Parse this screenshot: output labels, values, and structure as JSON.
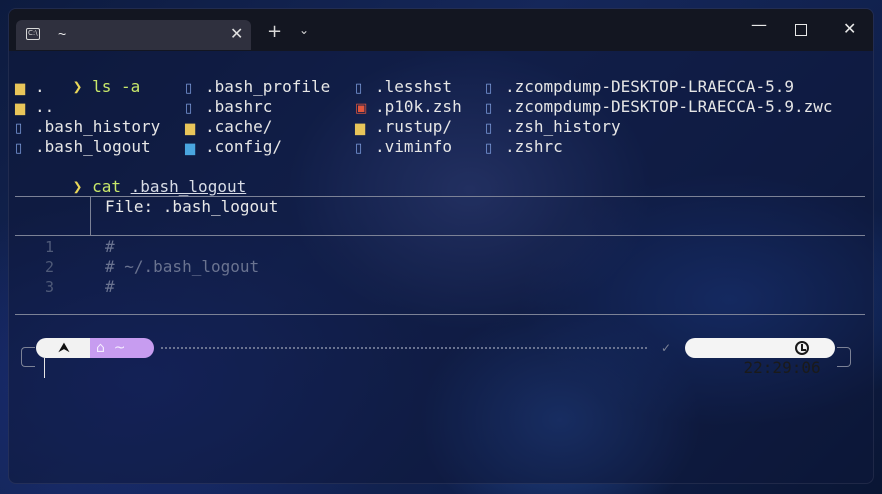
{
  "tab": {
    "icon": "terminal-icon",
    "title": "~",
    "close": "✕"
  },
  "titlebar": {
    "new_tab": "+",
    "dropdown": "⌄",
    "minimize": "—",
    "close": "✕"
  },
  "terminal": {
    "prompt_symbol": "❯",
    "command1": "ls -a",
    "listing": [
      [
        {
          "icon": "folder-icon",
          "glyph": "▆",
          "name": "."
        },
        {
          "icon": "folder-icon",
          "glyph": "▆",
          "name": ".."
        },
        {
          "icon": "file-icon",
          "glyph": "▯",
          "name": ".bash_history"
        },
        {
          "icon": "file-icon",
          "glyph": "▯",
          "name": ".bash_logout"
        }
      ],
      [
        {
          "icon": "file-icon",
          "glyph": "▯",
          "name": ".bash_profile"
        },
        {
          "icon": "file-icon",
          "glyph": "▯",
          "name": ".bashrc"
        },
        {
          "icon": "folder-icon",
          "glyph": "▆",
          "name": ".cache/"
        },
        {
          "icon": "config-folder-icon",
          "glyph": "▆",
          "name": ".config/"
        }
      ],
      [
        {
          "icon": "file-icon",
          "glyph": "▯",
          "name": ".lesshst"
        },
        {
          "icon": "script-icon",
          "glyph": "▣",
          "name": ".p10k.zsh"
        },
        {
          "icon": "folder-icon",
          "glyph": "▆",
          "name": ".rustup/"
        },
        {
          "icon": "file-icon",
          "glyph": "▯",
          "name": ".viminfo"
        }
      ],
      [
        {
          "icon": "file-icon",
          "glyph": "▯",
          "name": ".zcompdump-DESKTOP-LRAECCA-5.9"
        },
        {
          "icon": "file-icon",
          "glyph": "▯",
          "name": ".zcompdump-DESKTOP-LRAECCA-5.9.zwc"
        },
        {
          "icon": "file-icon",
          "glyph": "▯",
          "name": ".zsh_history"
        },
        {
          "icon": "file-icon",
          "glyph": "▯",
          "name": ".zshrc"
        }
      ]
    ],
    "command2": "cat",
    "command2_arg": ".bash_logout",
    "bat": {
      "file_header": "File: .bash_logout",
      "lines": [
        {
          "num": "1",
          "text": "#"
        },
        {
          "num": "2",
          "text": "# ~/.bash_logout"
        },
        {
          "num": "3",
          "text": "#"
        }
      ]
    },
    "prompt": {
      "os_icon": "⮝",
      "home_icon": "⌂",
      "dir": "~",
      "status_check": "✓",
      "time": "22:29:06"
    }
  }
}
